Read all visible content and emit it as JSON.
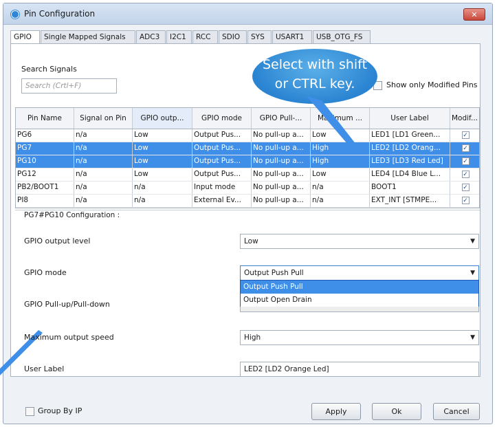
{
  "window": {
    "title": "Pin Configuration",
    "close_label": "✕"
  },
  "tabs": [
    {
      "label": "GPIO",
      "active": true
    },
    {
      "label": "Single Mapped Signals"
    },
    {
      "label": "ADC3"
    },
    {
      "label": "I2C1"
    },
    {
      "label": "RCC"
    },
    {
      "label": "SDIO"
    },
    {
      "label": "SYS"
    },
    {
      "label": "USART1"
    },
    {
      "label": "USB_OTG_FS"
    }
  ],
  "search": {
    "label": "Search Signals",
    "placeholder": "Search (Crtl+F)",
    "value": ""
  },
  "show_only_modified": {
    "label": "Show only Modified Pins",
    "checked": false
  },
  "callout": {
    "line1": "Select with shift",
    "line2": "or CTRL key."
  },
  "table": {
    "columns": [
      "Pin Name",
      "Signal on Pin",
      "GPIO outp...",
      "GPIO mode",
      "GPIO Pull-...",
      "Maximum ...",
      "User Label",
      "Modif..."
    ],
    "rows": [
      {
        "pin": "PG6",
        "signal": "n/a",
        "output": "Low",
        "mode": "Output Pus...",
        "pull": "No pull-up a...",
        "speed": "Low",
        "label": "LED1 [LD1 Green...",
        "modified": "✓",
        "selected": false
      },
      {
        "pin": "PG7",
        "signal": "n/a",
        "output": "Low",
        "mode": "Output Pus...",
        "pull": "No pull-up a...",
        "speed": "High",
        "label": "LED2 [LD2 Orang...",
        "modified": "✓",
        "selected": true
      },
      {
        "pin": "PG10",
        "signal": "n/a",
        "output": "Low",
        "mode": "Output Pus...",
        "pull": "No pull-up a...",
        "speed": "High",
        "label": "LED3 [LD3 Red Led]",
        "modified": "✓",
        "selected": true
      },
      {
        "pin": "PG12",
        "signal": "n/a",
        "output": "Low",
        "mode": "Output Pus...",
        "pull": "No pull-up a...",
        "speed": "Low",
        "label": "LED4 [LD4 Blue L...",
        "modified": "✓",
        "selected": false
      },
      {
        "pin": "PB2/BOOT1",
        "signal": "n/a",
        "output": "n/a",
        "mode": "Input mode",
        "pull": "No pull-up a...",
        "speed": "n/a",
        "label": "BOOT1",
        "modified": "✓",
        "selected": false
      },
      {
        "pin": "PI8",
        "signal": "n/a",
        "output": "n/a",
        "mode": "External Ev...",
        "pull": "No pull-up a...",
        "speed": "n/a",
        "label": "EXT_INT [STMPE...",
        "modified": "✓",
        "selected": false
      }
    ]
  },
  "config": {
    "title": "PG7#PG10 Configuration :",
    "output_level": {
      "label": "GPIO output level",
      "value": "Low"
    },
    "mode": {
      "label": "GPIO mode",
      "value": "Output Push Pull",
      "options": [
        "Output Push Pull",
        "Output Open Drain"
      ]
    },
    "pull": {
      "label": "GPIO Pull-up/Pull-down"
    },
    "speed": {
      "label": "Maximum output speed",
      "value": "High"
    },
    "user_label": {
      "label": "User Label",
      "value": "LED2 [LD2 Orange Led]"
    }
  },
  "group_by_ip": {
    "label": "Group By IP",
    "checked": false
  },
  "buttons": {
    "apply": "Apply",
    "ok": "Ok",
    "cancel": "Cancel"
  },
  "colors": {
    "selection": "#3f8fe8",
    "callout": "#2b84d2",
    "close": "#c9473a"
  }
}
